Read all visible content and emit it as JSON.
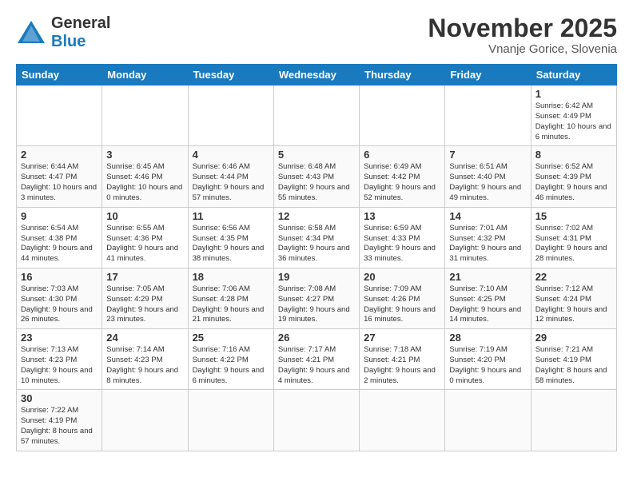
{
  "header": {
    "logo_general": "General",
    "logo_blue": "Blue",
    "cal_title": "November 2025",
    "cal_subtitle": "Vnanje Gorice, Slovenia"
  },
  "days_of_week": [
    "Sunday",
    "Monday",
    "Tuesday",
    "Wednesday",
    "Thursday",
    "Friday",
    "Saturday"
  ],
  "weeks": [
    [
      {
        "day": "",
        "info": ""
      },
      {
        "day": "",
        "info": ""
      },
      {
        "day": "",
        "info": ""
      },
      {
        "day": "",
        "info": ""
      },
      {
        "day": "",
        "info": ""
      },
      {
        "day": "",
        "info": ""
      },
      {
        "day": "1",
        "info": "Sunrise: 6:42 AM\nSunset: 4:49 PM\nDaylight: 10 hours and 6 minutes."
      }
    ],
    [
      {
        "day": "2",
        "info": "Sunrise: 6:44 AM\nSunset: 4:47 PM\nDaylight: 10 hours and 3 minutes."
      },
      {
        "day": "3",
        "info": "Sunrise: 6:45 AM\nSunset: 4:46 PM\nDaylight: 10 hours and 0 minutes."
      },
      {
        "day": "4",
        "info": "Sunrise: 6:46 AM\nSunset: 4:44 PM\nDaylight: 9 hours and 57 minutes."
      },
      {
        "day": "5",
        "info": "Sunrise: 6:48 AM\nSunset: 4:43 PM\nDaylight: 9 hours and 55 minutes."
      },
      {
        "day": "6",
        "info": "Sunrise: 6:49 AM\nSunset: 4:42 PM\nDaylight: 9 hours and 52 minutes."
      },
      {
        "day": "7",
        "info": "Sunrise: 6:51 AM\nSunset: 4:40 PM\nDaylight: 9 hours and 49 minutes."
      },
      {
        "day": "8",
        "info": "Sunrise: 6:52 AM\nSunset: 4:39 PM\nDaylight: 9 hours and 46 minutes."
      }
    ],
    [
      {
        "day": "9",
        "info": "Sunrise: 6:54 AM\nSunset: 4:38 PM\nDaylight: 9 hours and 44 minutes."
      },
      {
        "day": "10",
        "info": "Sunrise: 6:55 AM\nSunset: 4:36 PM\nDaylight: 9 hours and 41 minutes."
      },
      {
        "day": "11",
        "info": "Sunrise: 6:56 AM\nSunset: 4:35 PM\nDaylight: 9 hours and 38 minutes."
      },
      {
        "day": "12",
        "info": "Sunrise: 6:58 AM\nSunset: 4:34 PM\nDaylight: 9 hours and 36 minutes."
      },
      {
        "day": "13",
        "info": "Sunrise: 6:59 AM\nSunset: 4:33 PM\nDaylight: 9 hours and 33 minutes."
      },
      {
        "day": "14",
        "info": "Sunrise: 7:01 AM\nSunset: 4:32 PM\nDaylight: 9 hours and 31 minutes."
      },
      {
        "day": "15",
        "info": "Sunrise: 7:02 AM\nSunset: 4:31 PM\nDaylight: 9 hours and 28 minutes."
      }
    ],
    [
      {
        "day": "16",
        "info": "Sunrise: 7:03 AM\nSunset: 4:30 PM\nDaylight: 9 hours and 26 minutes."
      },
      {
        "day": "17",
        "info": "Sunrise: 7:05 AM\nSunset: 4:29 PM\nDaylight: 9 hours and 23 minutes."
      },
      {
        "day": "18",
        "info": "Sunrise: 7:06 AM\nSunset: 4:28 PM\nDaylight: 9 hours and 21 minutes."
      },
      {
        "day": "19",
        "info": "Sunrise: 7:08 AM\nSunset: 4:27 PM\nDaylight: 9 hours and 19 minutes."
      },
      {
        "day": "20",
        "info": "Sunrise: 7:09 AM\nSunset: 4:26 PM\nDaylight: 9 hours and 16 minutes."
      },
      {
        "day": "21",
        "info": "Sunrise: 7:10 AM\nSunset: 4:25 PM\nDaylight: 9 hours and 14 minutes."
      },
      {
        "day": "22",
        "info": "Sunrise: 7:12 AM\nSunset: 4:24 PM\nDaylight: 9 hours and 12 minutes."
      }
    ],
    [
      {
        "day": "23",
        "info": "Sunrise: 7:13 AM\nSunset: 4:23 PM\nDaylight: 9 hours and 10 minutes."
      },
      {
        "day": "24",
        "info": "Sunrise: 7:14 AM\nSunset: 4:23 PM\nDaylight: 9 hours and 8 minutes."
      },
      {
        "day": "25",
        "info": "Sunrise: 7:16 AM\nSunset: 4:22 PM\nDaylight: 9 hours and 6 minutes."
      },
      {
        "day": "26",
        "info": "Sunrise: 7:17 AM\nSunset: 4:21 PM\nDaylight: 9 hours and 4 minutes."
      },
      {
        "day": "27",
        "info": "Sunrise: 7:18 AM\nSunset: 4:21 PM\nDaylight: 9 hours and 2 minutes."
      },
      {
        "day": "28",
        "info": "Sunrise: 7:19 AM\nSunset: 4:20 PM\nDaylight: 9 hours and 0 minutes."
      },
      {
        "day": "29",
        "info": "Sunrise: 7:21 AM\nSunset: 4:19 PM\nDaylight: 8 hours and 58 minutes."
      }
    ],
    [
      {
        "day": "30",
        "info": "Sunrise: 7:22 AM\nSunset: 4:19 PM\nDaylight: 8 hours and 57 minutes."
      },
      {
        "day": "",
        "info": ""
      },
      {
        "day": "",
        "info": ""
      },
      {
        "day": "",
        "info": ""
      },
      {
        "day": "",
        "info": ""
      },
      {
        "day": "",
        "info": ""
      },
      {
        "day": "",
        "info": ""
      }
    ]
  ]
}
